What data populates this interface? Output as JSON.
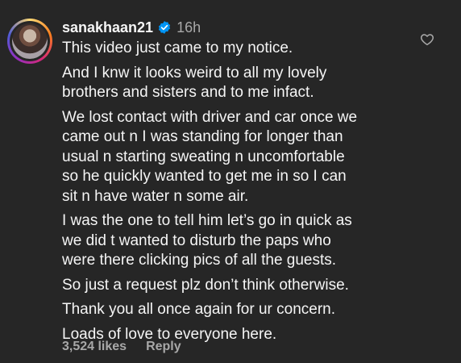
{
  "comment": {
    "username": "sanakhaan21",
    "time": "16h",
    "paragraphs": [
      "This video just came to my notice.",
      "And I knw it looks weird to all my lovely\nbrothers and sisters and to me infact.",
      "We lost contact with driver and car once we\ncame out n I was standing for longer than\nusual n starting sweating n uncomfortable\nso he quickly wanted to get me in so I can\nsit n have water n some air.",
      "I was the one to tell him let’s go in quick as\nwe did t wanted to disturb the paps who\nwere there clicking pics of all the guests.",
      "So just a request plz don’t think otherwise.",
      "Thank you all once again for ur concern.",
      "Loads of love to everyone here."
    ],
    "likes": "3,524 likes",
    "reply": "Reply"
  },
  "icons": {
    "verified": "verified-badge-icon",
    "like": "heart-outline-icon"
  },
  "colors": {
    "background": "#262626",
    "text": "#f5f5f5",
    "secondary": "#a8a8a8",
    "verified": "#0095f6"
  }
}
